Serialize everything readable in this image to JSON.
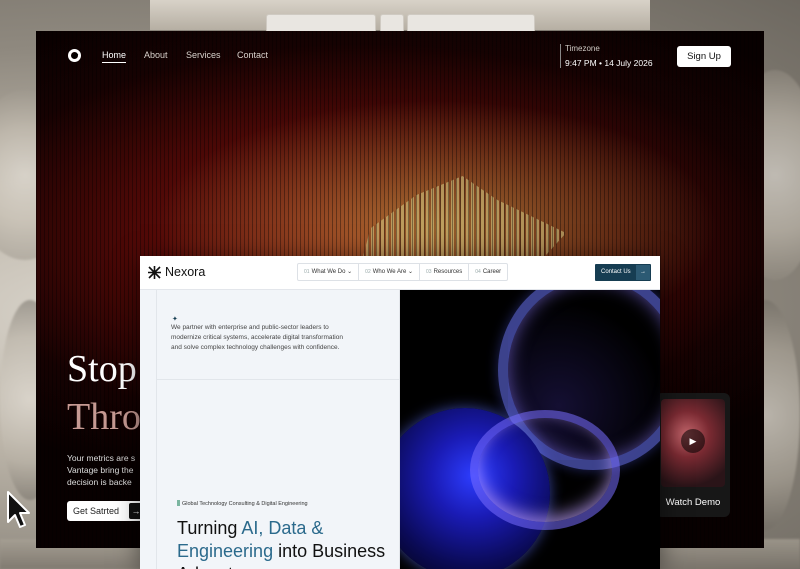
{
  "background_window": {
    "logo": "circle-logo-icon",
    "nav": [
      "Home",
      "About",
      "Services",
      "Contact"
    ],
    "active_nav": "Home",
    "timezone_label": "Timezone",
    "timezone_value": "9:47 PM  •  14 July 2026",
    "signup_label": "Sign Up",
    "hero_line1": "Stop",
    "hero_line2": "Thro",
    "hero_body": "Your metrics are s Vantage bring the decision is backe",
    "cta_label": "Get Satrted",
    "demo_label": "Watch Demo",
    "colors": {
      "hero_bg": "#4a0806",
      "accent_text": "#c69a93"
    }
  },
  "front_window": {
    "brand": "Nexora",
    "nav": [
      {
        "num": "01",
        "label": "What We Do",
        "has_dropdown": true
      },
      {
        "num": "02",
        "label": "Who We Are",
        "has_dropdown": true
      },
      {
        "num": "03",
        "label": "Resources",
        "has_dropdown": false
      },
      {
        "num": "04",
        "label": "Career",
        "has_dropdown": false
      }
    ],
    "contact_label": "Contact Us",
    "intro": "We partner with enterprise and public-sector leaders to modernize critical systems, accelerate digital transformation and solve complex technology challenges with confidence.",
    "tag": "Global Technology Consulting & Digital Engineering",
    "heading_part1": "Turning ",
    "heading_highlight": "AI, Data & Engineering",
    "heading_part2": " into Business Advantage.",
    "colors": {
      "primary": "#163d52",
      "highlight": "#2b6a8c",
      "tag_bar": "#7bb5a0"
    }
  }
}
